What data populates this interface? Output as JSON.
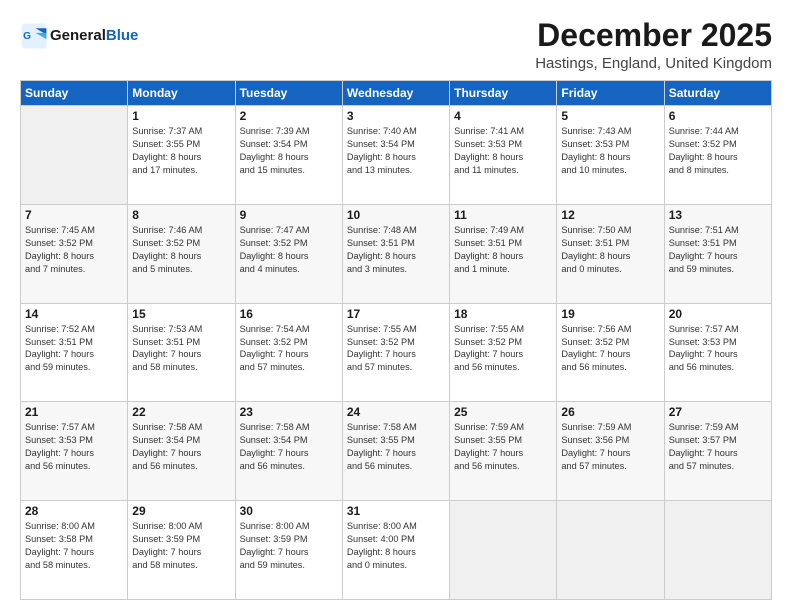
{
  "header": {
    "logo_line1": "General",
    "logo_line2": "Blue",
    "month_title": "December 2025",
    "location": "Hastings, England, United Kingdom"
  },
  "days_of_week": [
    "Sunday",
    "Monday",
    "Tuesday",
    "Wednesday",
    "Thursday",
    "Friday",
    "Saturday"
  ],
  "weeks": [
    [
      {
        "day": "",
        "info": ""
      },
      {
        "day": "1",
        "info": "Sunrise: 7:37 AM\nSunset: 3:55 PM\nDaylight: 8 hours\nand 17 minutes."
      },
      {
        "day": "2",
        "info": "Sunrise: 7:39 AM\nSunset: 3:54 PM\nDaylight: 8 hours\nand 15 minutes."
      },
      {
        "day": "3",
        "info": "Sunrise: 7:40 AM\nSunset: 3:54 PM\nDaylight: 8 hours\nand 13 minutes."
      },
      {
        "day": "4",
        "info": "Sunrise: 7:41 AM\nSunset: 3:53 PM\nDaylight: 8 hours\nand 11 minutes."
      },
      {
        "day": "5",
        "info": "Sunrise: 7:43 AM\nSunset: 3:53 PM\nDaylight: 8 hours\nand 10 minutes."
      },
      {
        "day": "6",
        "info": "Sunrise: 7:44 AM\nSunset: 3:52 PM\nDaylight: 8 hours\nand 8 minutes."
      }
    ],
    [
      {
        "day": "7",
        "info": "Sunrise: 7:45 AM\nSunset: 3:52 PM\nDaylight: 8 hours\nand 7 minutes."
      },
      {
        "day": "8",
        "info": "Sunrise: 7:46 AM\nSunset: 3:52 PM\nDaylight: 8 hours\nand 5 minutes."
      },
      {
        "day": "9",
        "info": "Sunrise: 7:47 AM\nSunset: 3:52 PM\nDaylight: 8 hours\nand 4 minutes."
      },
      {
        "day": "10",
        "info": "Sunrise: 7:48 AM\nSunset: 3:51 PM\nDaylight: 8 hours\nand 3 minutes."
      },
      {
        "day": "11",
        "info": "Sunrise: 7:49 AM\nSunset: 3:51 PM\nDaylight: 8 hours\nand 1 minute."
      },
      {
        "day": "12",
        "info": "Sunrise: 7:50 AM\nSunset: 3:51 PM\nDaylight: 8 hours\nand 0 minutes."
      },
      {
        "day": "13",
        "info": "Sunrise: 7:51 AM\nSunset: 3:51 PM\nDaylight: 7 hours\nand 59 minutes."
      }
    ],
    [
      {
        "day": "14",
        "info": "Sunrise: 7:52 AM\nSunset: 3:51 PM\nDaylight: 7 hours\nand 59 minutes."
      },
      {
        "day": "15",
        "info": "Sunrise: 7:53 AM\nSunset: 3:51 PM\nDaylight: 7 hours\nand 58 minutes."
      },
      {
        "day": "16",
        "info": "Sunrise: 7:54 AM\nSunset: 3:52 PM\nDaylight: 7 hours\nand 57 minutes."
      },
      {
        "day": "17",
        "info": "Sunrise: 7:55 AM\nSunset: 3:52 PM\nDaylight: 7 hours\nand 57 minutes."
      },
      {
        "day": "18",
        "info": "Sunrise: 7:55 AM\nSunset: 3:52 PM\nDaylight: 7 hours\nand 56 minutes."
      },
      {
        "day": "19",
        "info": "Sunrise: 7:56 AM\nSunset: 3:52 PM\nDaylight: 7 hours\nand 56 minutes."
      },
      {
        "day": "20",
        "info": "Sunrise: 7:57 AM\nSunset: 3:53 PM\nDaylight: 7 hours\nand 56 minutes."
      }
    ],
    [
      {
        "day": "21",
        "info": "Sunrise: 7:57 AM\nSunset: 3:53 PM\nDaylight: 7 hours\nand 56 minutes."
      },
      {
        "day": "22",
        "info": "Sunrise: 7:58 AM\nSunset: 3:54 PM\nDaylight: 7 hours\nand 56 minutes."
      },
      {
        "day": "23",
        "info": "Sunrise: 7:58 AM\nSunset: 3:54 PM\nDaylight: 7 hours\nand 56 minutes."
      },
      {
        "day": "24",
        "info": "Sunrise: 7:58 AM\nSunset: 3:55 PM\nDaylight: 7 hours\nand 56 minutes."
      },
      {
        "day": "25",
        "info": "Sunrise: 7:59 AM\nSunset: 3:55 PM\nDaylight: 7 hours\nand 56 minutes."
      },
      {
        "day": "26",
        "info": "Sunrise: 7:59 AM\nSunset: 3:56 PM\nDaylight: 7 hours\nand 57 minutes."
      },
      {
        "day": "27",
        "info": "Sunrise: 7:59 AM\nSunset: 3:57 PM\nDaylight: 7 hours\nand 57 minutes."
      }
    ],
    [
      {
        "day": "28",
        "info": "Sunrise: 8:00 AM\nSunset: 3:58 PM\nDaylight: 7 hours\nand 58 minutes."
      },
      {
        "day": "29",
        "info": "Sunrise: 8:00 AM\nSunset: 3:59 PM\nDaylight: 7 hours\nand 58 minutes."
      },
      {
        "day": "30",
        "info": "Sunrise: 8:00 AM\nSunset: 3:59 PM\nDaylight: 7 hours\nand 59 minutes."
      },
      {
        "day": "31",
        "info": "Sunrise: 8:00 AM\nSunset: 4:00 PM\nDaylight: 8 hours\nand 0 minutes."
      },
      {
        "day": "",
        "info": ""
      },
      {
        "day": "",
        "info": ""
      },
      {
        "day": "",
        "info": ""
      }
    ]
  ]
}
